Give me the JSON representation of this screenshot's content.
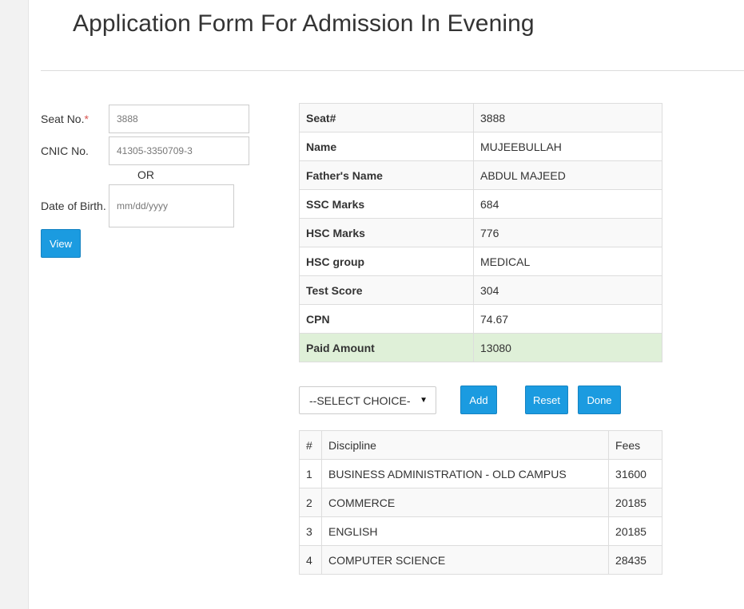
{
  "page": {
    "title": "Application Form For Admission In Evening"
  },
  "form": {
    "seat_label": "Seat No.",
    "required_mark": "*",
    "seat_value": "3888",
    "cnic_label": "CNIC No.",
    "cnic_value": "41305-3350709-3",
    "or_text": "OR",
    "dob_label": "Date of Birth.",
    "dob_placeholder": "mm/dd/yyyy",
    "view_button": "View"
  },
  "info": {
    "rows": [
      {
        "label": "Seat#",
        "value": "3888"
      },
      {
        "label": "Name",
        "value": "MUJEEBULLAH"
      },
      {
        "label": "Father's Name",
        "value": "ABDUL MAJEED"
      },
      {
        "label": "SSC Marks",
        "value": "684"
      },
      {
        "label": "HSC Marks",
        "value": "776"
      },
      {
        "label": "HSC group",
        "value": "MEDICAL"
      },
      {
        "label": "Test Score",
        "value": "304"
      },
      {
        "label": "CPN",
        "value": "74.67"
      },
      {
        "label": "Paid Amount",
        "value": "13080"
      }
    ]
  },
  "choice": {
    "selected": "--SELECT CHOICE-",
    "add_button": "Add",
    "reset_button": "Reset",
    "done_button": "Done"
  },
  "disciplines": {
    "headers": [
      "#",
      "Discipline",
      "Fees"
    ],
    "rows": [
      {
        "num": "1",
        "name": "BUSINESS ADMINISTRATION - OLD CAMPUS",
        "fee": "31600"
      },
      {
        "num": "2",
        "name": "COMMERCE",
        "fee": "20185"
      },
      {
        "num": "3",
        "name": "ENGLISH",
        "fee": "20185"
      },
      {
        "num": "4",
        "name": "COMPUTER SCIENCE",
        "fee": "28435"
      }
    ]
  },
  "colors": {
    "accent": "#1b9be0",
    "success_row": "#dff0d8",
    "required": "#d9534f"
  }
}
